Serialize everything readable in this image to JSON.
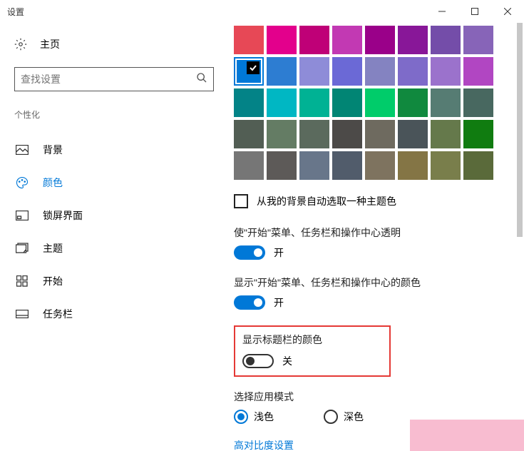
{
  "window": {
    "title": "设置"
  },
  "sidebar": {
    "home": "主页",
    "searchPlaceholder": "查找设置",
    "category": "个性化",
    "items": [
      {
        "label": "背景"
      },
      {
        "label": "颜色"
      },
      {
        "label": "锁屏界面"
      },
      {
        "label": "主题"
      },
      {
        "label": "开始"
      },
      {
        "label": "任务栏"
      }
    ]
  },
  "colors": {
    "palette": [
      "#e74856",
      "#e3008c",
      "#bf0077",
      "#c239b3",
      "#9a0089",
      "#881798",
      "#744da9",
      "#8764b8",
      "#0078d7",
      "#2d7dd2",
      "#8e8cd8",
      "#6b69d6",
      "#8483c1",
      "#7e6bc9",
      "#9b72cc",
      "#b146c2",
      "#038387",
      "#00b7c3",
      "#00b294",
      "#018574",
      "#00cc6a",
      "#10893e",
      "#567c73",
      "#486860",
      "#525e54",
      "#647c64",
      "#5b6a5d",
      "#4c4a48",
      "#6e6a5f",
      "#4a5459",
      "#65794b",
      "#107c10",
      "#767676",
      "#5d5a58",
      "#68768a",
      "#515c6b",
      "#7e735f",
      "#847545",
      "#797e4b",
      "#5a6a3a"
    ],
    "selectedIndex": 8,
    "autoLabel": "从我的背景自动选取一种主题色"
  },
  "settings": {
    "transparency": {
      "label": "使\"开始\"菜单、任务栏和操作中心透明",
      "state": "开",
      "on": true
    },
    "showColor": {
      "label": "显示\"开始\"菜单、任务栏和操作中心的颜色",
      "state": "开",
      "on": true
    },
    "titlebarColor": {
      "label": "显示标题栏的颜色",
      "state": "关",
      "on": false
    },
    "appMode": {
      "label": "选择应用模式",
      "light": "浅色",
      "dark": "深色",
      "selected": "light"
    },
    "highContrastLink": "高对比度设置"
  }
}
